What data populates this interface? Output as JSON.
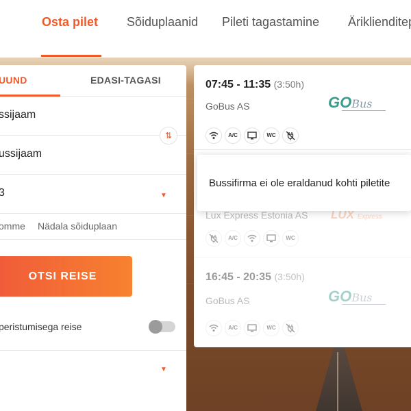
{
  "nav": {
    "items": [
      {
        "label": "Osta pilet",
        "active": true
      },
      {
        "label": "Sõiduplaanid",
        "active": false
      },
      {
        "label": "Pileti tagastamine",
        "active": false
      },
      {
        "label": "Äriklienditep",
        "active": false
      }
    ],
    "accent_color": "#f05a28"
  },
  "search": {
    "tabs": [
      {
        "label": "UUND",
        "active": true
      },
      {
        "label": "EDASI-TAGASI",
        "active": false
      }
    ],
    "from_value": "ssijaam",
    "to_value": "ussijaam",
    "date_value": "3",
    "swap_icon": "swap-arrows-icon",
    "links": [
      "omme",
      "Nädala sõiduplaan"
    ],
    "search_button": "OTSI REISE",
    "transfer_toggle_label": "peristumisega reise",
    "transfer_toggle_on": false
  },
  "results": {
    "trips": [
      {
        "time": "07:45 - 11:35",
        "duration": "(3:50h)",
        "company": "GoBus AS",
        "logo": "GoBus",
        "amenities": [
          "wifi-icon",
          "A/C",
          "screen-icon",
          "WC",
          "no-power-icon"
        ]
      },
      {
        "company": "Lux Express Estonia AS",
        "logo": "LUX Express",
        "amenities": [
          "no-power-icon",
          "A/C",
          "wifi-icon",
          "screen-icon",
          "WC"
        ]
      },
      {
        "time": "16:45 - 20:35",
        "duration": "(3:50h)",
        "company": "GoBus AS",
        "logo": "GoBus",
        "amenities": [
          "wifi-icon",
          "A/C",
          "screen-icon",
          "WC",
          "no-power-icon"
        ]
      }
    ],
    "tooltip": "Bussifirma ei ole eraldanud kohti piletite"
  }
}
